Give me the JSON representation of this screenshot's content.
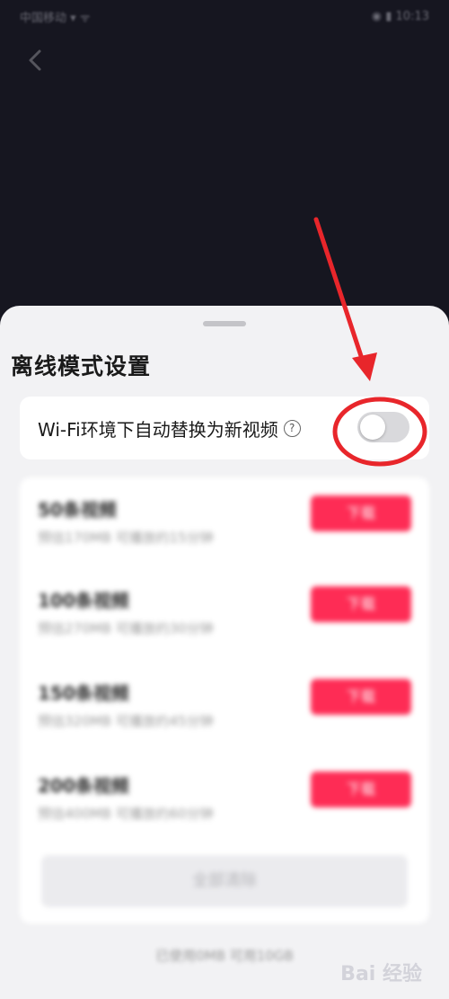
{
  "status_bar": {
    "left": "中国移动 ▾ ᯤ",
    "right": "◉ ▮ 10:13"
  },
  "sheet": {
    "title": "离线模式设置",
    "wifi_setting": {
      "label": "Wi-Fi环境下自动替换为新视频",
      "help_glyph": "?",
      "toggle_on": false
    },
    "packages": [
      {
        "name": "50条视频",
        "desc": "预估170MB 可播放约15分钟",
        "button": "下载"
      },
      {
        "name": "100条视频",
        "desc": "预估270MB 可播放约30分钟",
        "button": "下载"
      },
      {
        "name": "150条视频",
        "desc": "预估320MB 可播放约45分钟",
        "button": "下载"
      },
      {
        "name": "200条视频",
        "desc": "预估400MB 可播放约60分钟",
        "button": "下载"
      }
    ],
    "delete_all": "全部清除",
    "storage_info": "已使用0MB 可用10GB"
  },
  "watermark": "Bai 经验",
  "colors": {
    "accent": "#fe2c55",
    "annotation_red": "#e8262b",
    "background_dark": "#161620",
    "sheet_background": "#f2f2f4"
  },
  "icons": {
    "back": "chevron-left-icon",
    "help": "question-circle-icon"
  }
}
